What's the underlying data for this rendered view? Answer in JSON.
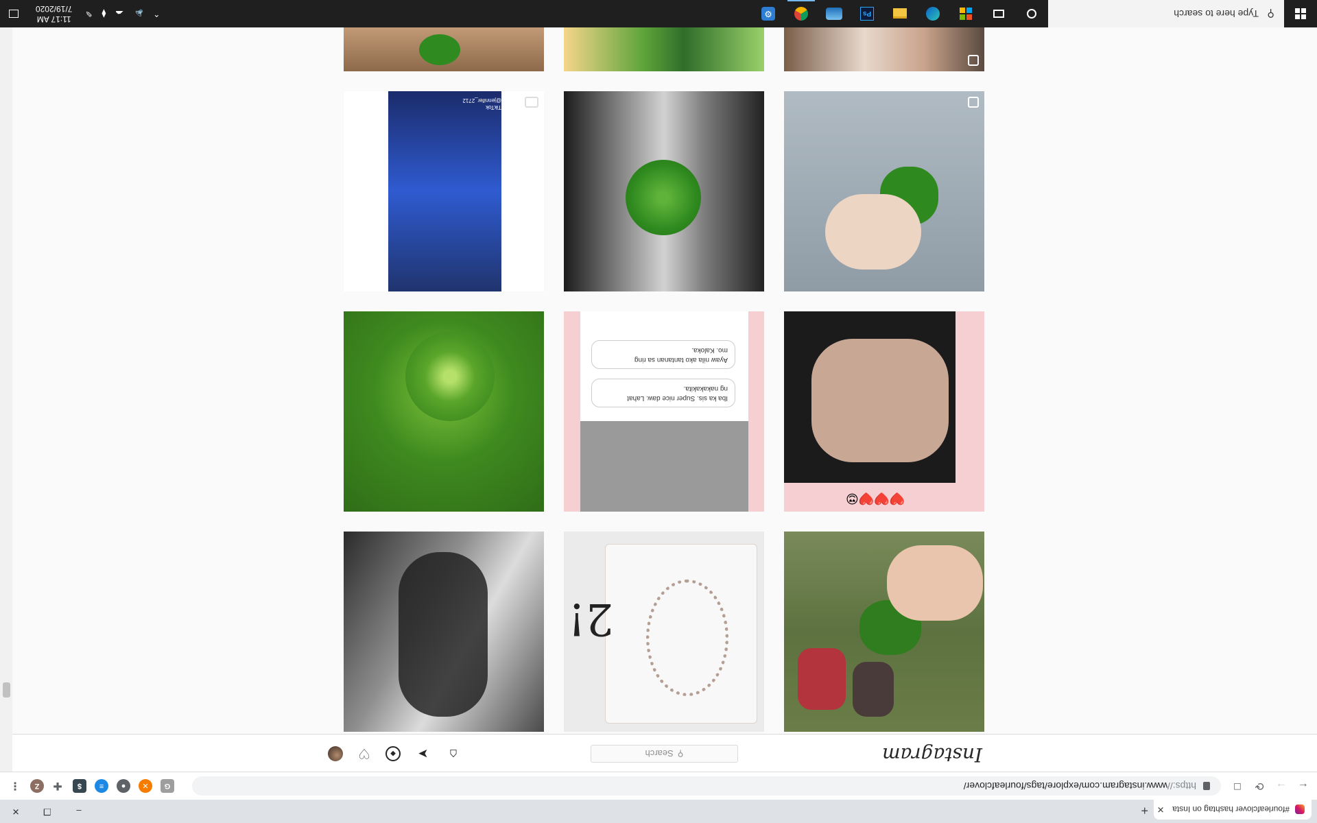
{
  "browser": {
    "tab_title": "#fourleafclover hashtag on Insta",
    "tab_close": "✕",
    "new_tab": "+",
    "window_controls": [
      "–",
      "❐",
      "✕"
    ],
    "url_protocol": "https://",
    "url_rest": "www.instagram.com/explore/tags/fourleafclover/",
    "nav_icons": [
      "back-arrow-icon",
      "forward-arrow-icon",
      "reload-icon",
      "bookmark-icon"
    ],
    "extensions": [
      "extension-g-icon",
      "extension-x-icon",
      "extension-chrome-icon",
      "extension-blue-icon",
      "extension-dollar-icon",
      "puzzle-icon",
      "profile-avatar-icon",
      "kebab-menu-icon"
    ],
    "profile_initial": "Z"
  },
  "instagram": {
    "logo": "Instagram",
    "search_placeholder": "Search",
    "nav_icons": [
      "home-icon",
      "direct-icon",
      "explore-icon",
      "heart-icon",
      "profile-avatar-icon"
    ]
  },
  "posts": [
    {
      "desc": "clover-on-red-sneakers",
      "multi": false
    },
    {
      "desc": "pandora-bracelet",
      "multi": false
    },
    {
      "desc": "black-white-workout",
      "multi": false
    },
    {
      "desc": "ring-hand-pink",
      "multi": false
    },
    {
      "desc": "ring-chat-screenshot",
      "multi": false
    },
    {
      "desc": "four-leaf-clover-grass",
      "multi": false
    },
    {
      "desc": "tiktok-video",
      "multi": false
    },
    {
      "desc": "clover-on-hand",
      "multi": false
    },
    {
      "desc": "clover-held-gray",
      "multi": true
    },
    {
      "desc": "partial-clover-fur",
      "multi": false
    },
    {
      "desc": "partial-green-leaves",
      "multi": false
    },
    {
      "desc": "partial-hair",
      "multi": true
    }
  ],
  "post_texts": {
    "chat_line_1": "Ayaw nila ako tantanan sa ring",
    "chat_line_2": "mo. Kaloka.",
    "chat_line_3": "Iba ka sis. Super nice daw. Lahat",
    "chat_line_4": "ng nakakakita.",
    "tiktok_label": "TikTok",
    "tiktok_user": "@jennifer_2712",
    "emoji_row": "❤️❤️❤️😍"
  },
  "taskbar": {
    "search_placeholder": "Type here to search",
    "apps": [
      "cortana-icon",
      "task-view-icon",
      "microsoft-store-icon",
      "edge-icon",
      "file-explorer-icon",
      "photoshop-icon",
      "onedrive-cloud-icon",
      "chrome-icon",
      "settings-gear-icon"
    ],
    "tray_icons": [
      "chevron-up-icon",
      "volume-icon",
      "onedrive-icon",
      "dropbox-icon",
      "pen-icon"
    ],
    "time": "11:17 AM",
    "date": "7/19/2020"
  },
  "colors": {
    "taskbar": "#1f1f1f",
    "ig_border": "#dbdbdb",
    "accent": "#76b9ed"
  }
}
